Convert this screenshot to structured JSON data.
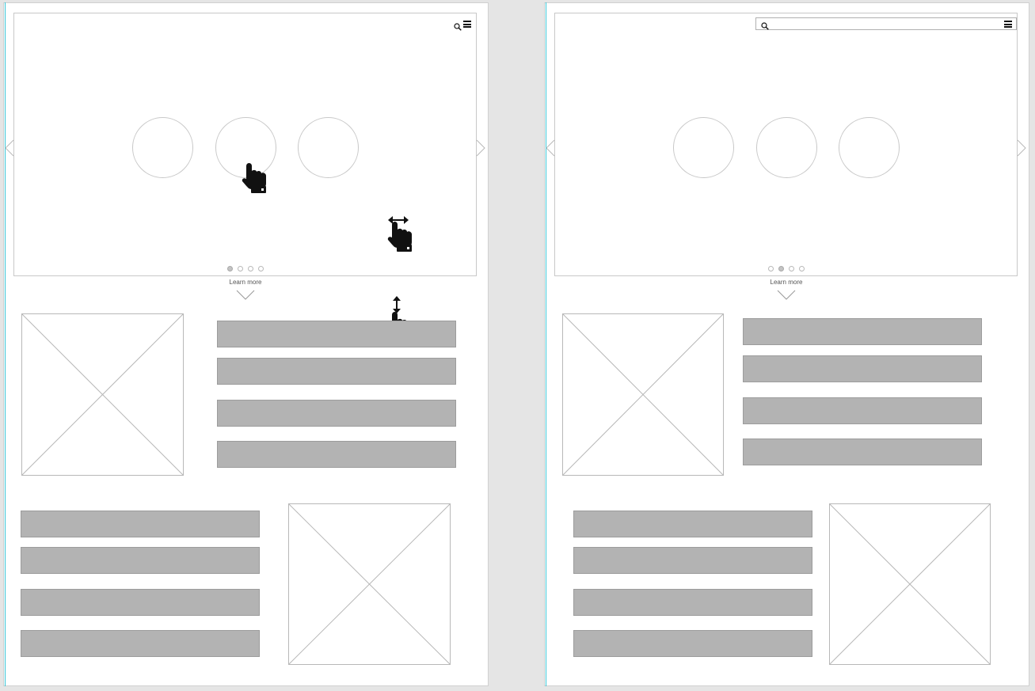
{
  "colors": {
    "bar_fill": "#b3b3b3",
    "guide_line": "#39c6d8",
    "canvas_bg": "#e5e5e5"
  },
  "frames": [
    {
      "name": "frame-1",
      "header": {
        "icons": [
          "search-icon",
          "menu-icon"
        ]
      },
      "carousel": {
        "circles": 3,
        "pages": 4,
        "active_page": 1,
        "learn_more": "Learn more"
      },
      "gestures": [
        "tap",
        "swipe-horizontal",
        "swipe-vertical"
      ]
    },
    {
      "name": "frame-2",
      "header": {
        "icons": [
          "search-icon",
          "menu-icon"
        ],
        "search_expanded": true,
        "search_value": ""
      },
      "carousel": {
        "circles": 3,
        "pages": 4,
        "active_page": 2,
        "learn_more": "Learn more"
      }
    }
  ]
}
